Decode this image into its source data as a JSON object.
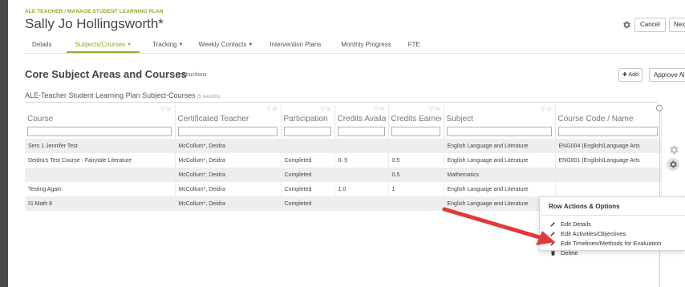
{
  "header": {
    "breadcrumb": "ALE TEACHER / MANAGE STUDENT LEARNING PLAN",
    "student_name": "Sally Jo Hollingsworth*",
    "cancel_label": "Cancel",
    "next_label": "Next"
  },
  "tabs": [
    {
      "label": "Details",
      "dropdown": false
    },
    {
      "label": "Subjects/Courses",
      "dropdown": true,
      "active": true
    },
    {
      "label": "Tracking",
      "dropdown": true
    },
    {
      "label": "Weekly Contacts",
      "dropdown": true
    },
    {
      "label": "Intervention Plans",
      "dropdown": false
    },
    {
      "label": "Monthly Progress",
      "dropdown": false
    },
    {
      "label": "FTE",
      "dropdown": false
    }
  ],
  "section": {
    "title": "Core Subject Areas and Courses",
    "instructions_label": "Instructions",
    "add_label": "Add",
    "approve_label": "Approve All"
  },
  "table": {
    "title": "ALE-Teacher Student Learning Plan Subject-Courses",
    "records": "(5 records)",
    "columns": [
      "Course",
      "Certificated Teacher",
      "Participation",
      "Credits Available",
      "Credits Earned",
      "Subject",
      "Course Code / Name"
    ],
    "rows": [
      [
        "Sem 1 Jennifer Test",
        "McCollum*, Deidra",
        "",
        "",
        "",
        "English Language and Literature",
        "ENG004 (English/Language Arts"
      ],
      [
        "Deidra's Test Course - Fairytale Literature",
        "McCollum*, Deidra",
        "Completed",
        "0. 5",
        "0.5",
        "English Language and Literature",
        "ENG001 (English/Language Arts"
      ],
      [
        "",
        "McCollum*, Deidra",
        "Completed",
        "",
        "0.5",
        "Mathematics",
        ""
      ],
      [
        "Testing Again",
        "McCollum*, Deidra",
        "Completed",
        "1.0",
        "1",
        "English Language and Literature",
        ""
      ],
      [
        "IS Math 8",
        "McCollum*, Deidra",
        "Completed",
        "",
        "",
        "English Language and Literature",
        ""
      ]
    ]
  },
  "row_menu": {
    "title": "Row Actions & Options",
    "items": [
      {
        "label": "Edit Details",
        "icon": "pencil-icon"
      },
      {
        "label": "Edit Activities/Objectives",
        "icon": "pencil-icon"
      },
      {
        "label": "Edit Timelines/Methods for Evaluation",
        "icon": "pencil-icon"
      },
      {
        "label": "Delete",
        "icon": "trash-icon"
      }
    ]
  },
  "colors": {
    "accent": "#8bab2a",
    "arrow": "#e03a3a"
  }
}
